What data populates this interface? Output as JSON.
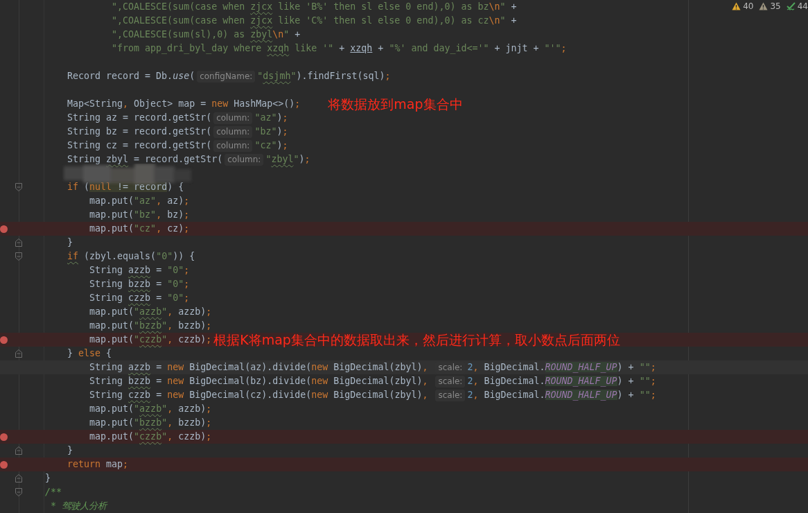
{
  "inspections": [
    {
      "kind": "warning",
      "count": "40"
    },
    {
      "kind": "weak-warning",
      "count": "35"
    },
    {
      "kind": "typo",
      "count": "44"
    }
  ],
  "redaction": {
    "kind": "mosaic"
  },
  "lines": [
    {
      "tokens": [
        {
          "kind": "str",
          "text": "            \",COALESCE(sum(case when "
        },
        {
          "kind": "str",
          "text": "zjcx",
          "typo": true
        },
        {
          "kind": "str",
          "text": " like 'B%' then sl else 0 end),0) as bz"
        },
        {
          "kind": "esc",
          "text": "\\n"
        },
        {
          "kind": "str",
          "text": "\""
        },
        {
          "kind": "plain",
          "text": " +"
        }
      ]
    },
    {
      "tokens": [
        {
          "kind": "str",
          "text": "            \",COALESCE(sum(case when "
        },
        {
          "kind": "str",
          "text": "zjcx",
          "typo": true
        },
        {
          "kind": "str",
          "text": " like 'C%' then sl else 0 end),0) as cz"
        },
        {
          "kind": "esc",
          "text": "\\n"
        },
        {
          "kind": "str",
          "text": "\""
        },
        {
          "kind": "plain",
          "text": " +"
        }
      ]
    },
    {
      "tokens": [
        {
          "kind": "str",
          "text": "            \",COALESCE(sum(sl),0) as "
        },
        {
          "kind": "str",
          "text": "zbyl",
          "typo": true
        },
        {
          "kind": "esc",
          "text": "\\n"
        },
        {
          "kind": "str",
          "text": "\""
        },
        {
          "kind": "plain",
          "text": " +"
        }
      ]
    },
    {
      "tokens": [
        {
          "kind": "str",
          "text": "            \"from app_dri_byl_day where "
        },
        {
          "kind": "str",
          "text": "xzqh",
          "typo": true
        },
        {
          "kind": "str",
          "text": " like '\""
        },
        {
          "kind": "plain",
          "text": " + "
        },
        {
          "kind": "param",
          "text": "xzqh"
        },
        {
          "kind": "plain",
          "text": " + "
        },
        {
          "kind": "str",
          "text": "\"%' and day_id<='\""
        },
        {
          "kind": "plain",
          "text": " + jnjt + "
        },
        {
          "kind": "str",
          "text": "\"'\""
        },
        {
          "kind": "kw",
          "text": ";"
        }
      ]
    },
    {
      "kind": "blank"
    },
    {
      "tokens": [
        {
          "kind": "plain",
          "text": "    Record record = Db."
        },
        {
          "kind": "static",
          "text": "use"
        },
        {
          "kind": "plain",
          "text": "("
        },
        {
          "kind": "hint",
          "text": "configName:"
        },
        {
          "kind": "str",
          "text": "\""
        },
        {
          "kind": "str",
          "text": "dsjmh",
          "typo": true
        },
        {
          "kind": "str",
          "text": "\""
        },
        {
          "kind": "plain",
          "text": ").findFirst(sql)"
        },
        {
          "kind": "kw",
          "text": ";"
        }
      ]
    },
    {
      "kind": "blank"
    },
    {
      "tokens": [
        {
          "kind": "plain",
          "text": "    Map<String"
        },
        {
          "kind": "kw",
          "text": ","
        },
        {
          "kind": "plain",
          "text": " Object> map = "
        },
        {
          "kind": "kw",
          "text": "new"
        },
        {
          "kind": "plain",
          "text": " HashMap<>()"
        },
        {
          "kind": "kw",
          "text": ";"
        }
      ],
      "note": "将数据放到map集合中"
    },
    {
      "tokens": [
        {
          "kind": "plain",
          "text": "    String az = record.getStr("
        },
        {
          "kind": "hint",
          "text": "column:"
        },
        {
          "kind": "str",
          "text": "\"az\""
        },
        {
          "kind": "plain",
          "text": ")"
        },
        {
          "kind": "kw",
          "text": ";"
        }
      ]
    },
    {
      "tokens": [
        {
          "kind": "plain",
          "text": "    String bz = record.getStr("
        },
        {
          "kind": "hint",
          "text": "column:"
        },
        {
          "kind": "str",
          "text": "\"bz\""
        },
        {
          "kind": "plain",
          "text": ")"
        },
        {
          "kind": "kw",
          "text": ";"
        }
      ]
    },
    {
      "tokens": [
        {
          "kind": "plain",
          "text": "    String cz = record.getStr("
        },
        {
          "kind": "hint",
          "text": "column:"
        },
        {
          "kind": "str",
          "text": "\"cz\""
        },
        {
          "kind": "plain",
          "text": ")"
        },
        {
          "kind": "kw",
          "text": ";"
        }
      ]
    },
    {
      "tokens": [
        {
          "kind": "plain",
          "text": "    String "
        },
        {
          "kind": "plain",
          "text": "zbyl",
          "typo": true
        },
        {
          "kind": "plain",
          "text": " = record.getStr("
        },
        {
          "kind": "hint",
          "text": "column:"
        },
        {
          "kind": "str",
          "text": "\""
        },
        {
          "kind": "str",
          "text": "zbyl",
          "typo": true
        },
        {
          "kind": "str",
          "text": "\""
        },
        {
          "kind": "plain",
          "text": ")"
        },
        {
          "kind": "kw",
          "text": ";"
        }
      ]
    },
    {
      "kind": "blank"
    },
    {
      "fold_start": true,
      "tokens": [
        {
          "kind": "kw",
          "text": "    if"
        },
        {
          "kind": "plain",
          "text": " ("
        },
        {
          "kind": "kw",
          "text": "null",
          "highlight": true
        },
        {
          "kind": "plain",
          "text": " != record",
          "highlight": true
        },
        {
          "kind": "plain",
          "text": ") {"
        }
      ]
    },
    {
      "tokens": [
        {
          "kind": "plain",
          "text": "        map.put("
        },
        {
          "kind": "str",
          "text": "\"az\""
        },
        {
          "kind": "kw",
          "text": ","
        },
        {
          "kind": "plain",
          "text": " az)"
        },
        {
          "kind": "kw",
          "text": ";"
        }
      ]
    },
    {
      "tokens": [
        {
          "kind": "plain",
          "text": "        map.put("
        },
        {
          "kind": "str",
          "text": "\"bz\""
        },
        {
          "kind": "kw",
          "text": ","
        },
        {
          "kind": "plain",
          "text": " bz)"
        },
        {
          "kind": "kw",
          "text": ";"
        }
      ]
    },
    {
      "breakpoint": true,
      "tokens": [
        {
          "kind": "plain",
          "text": "        map.put("
        },
        {
          "kind": "str",
          "text": "\"cz\""
        },
        {
          "kind": "kw",
          "text": ","
        },
        {
          "kind": "plain",
          "text": " cz)"
        },
        {
          "kind": "kw",
          "text": ";"
        }
      ]
    },
    {
      "fold_end": true,
      "tokens": [
        {
          "kind": "plain",
          "text": "    }"
        }
      ]
    },
    {
      "fold_start": true,
      "tokens": [
        {
          "kind": "kw",
          "text": "    if",
          "typo": true
        },
        {
          "kind": "plain",
          "text": " (zbyl.equals("
        },
        {
          "kind": "str",
          "text": "\"0\""
        },
        {
          "kind": "plain",
          "text": ")) {"
        }
      ]
    },
    {
      "tokens": [
        {
          "kind": "plain",
          "text": "        String "
        },
        {
          "kind": "plain",
          "text": "azzb",
          "typo": true
        },
        {
          "kind": "plain",
          "text": " = "
        },
        {
          "kind": "str",
          "text": "\"0\""
        },
        {
          "kind": "kw",
          "text": ";"
        }
      ]
    },
    {
      "tokens": [
        {
          "kind": "plain",
          "text": "        String "
        },
        {
          "kind": "plain",
          "text": "bzzb",
          "typo": true
        },
        {
          "kind": "plain",
          "text": " = "
        },
        {
          "kind": "str",
          "text": "\"0\""
        },
        {
          "kind": "kw",
          "text": ";"
        }
      ]
    },
    {
      "tokens": [
        {
          "kind": "plain",
          "text": "        String "
        },
        {
          "kind": "plain",
          "text": "czzb",
          "typo": true
        },
        {
          "kind": "plain",
          "text": " = "
        },
        {
          "kind": "str",
          "text": "\"0\""
        },
        {
          "kind": "kw",
          "text": ";"
        }
      ]
    },
    {
      "tokens": [
        {
          "kind": "plain",
          "text": "        map.put("
        },
        {
          "kind": "str",
          "text": "\""
        },
        {
          "kind": "str",
          "text": "azzb",
          "typo": true
        },
        {
          "kind": "str",
          "text": "\""
        },
        {
          "kind": "kw",
          "text": ","
        },
        {
          "kind": "plain",
          "text": " azzb)"
        },
        {
          "kind": "kw",
          "text": ";"
        }
      ]
    },
    {
      "tokens": [
        {
          "kind": "plain",
          "text": "        map.put("
        },
        {
          "kind": "str",
          "text": "\""
        },
        {
          "kind": "str",
          "text": "bzzb",
          "typo": true
        },
        {
          "kind": "str",
          "text": "\""
        },
        {
          "kind": "kw",
          "text": ","
        },
        {
          "kind": "plain",
          "text": " bzzb)"
        },
        {
          "kind": "kw",
          "text": ";"
        }
      ]
    },
    {
      "breakpoint": true,
      "tokens": [
        {
          "kind": "plain",
          "text": "        map.put("
        },
        {
          "kind": "str",
          "text": "\""
        },
        {
          "kind": "str",
          "text": "czzb",
          "typo": true
        },
        {
          "kind": "str",
          "text": "\""
        },
        {
          "kind": "kw",
          "text": ","
        },
        {
          "kind": "plain",
          "text": " czzb)"
        },
        {
          "kind": "kw",
          "text": ";"
        }
      ],
      "note": "根据K将map集合中的数据取出来，然后进行计算，取小数点后面两位"
    },
    {
      "fold_end": true,
      "tokens": [
        {
          "kind": "plain",
          "text": "    } "
        },
        {
          "kind": "kw",
          "text": "else"
        },
        {
          "kind": "plain",
          "text": " {"
        }
      ]
    },
    {
      "current": true,
      "tokens": [
        {
          "kind": "plain",
          "text": "        String "
        },
        {
          "kind": "plain",
          "text": "azzb",
          "typo": true
        },
        {
          "kind": "plain",
          "text": " = "
        },
        {
          "kind": "kw",
          "text": "new"
        },
        {
          "kind": "plain",
          "text": " BigDecimal(az).divide("
        },
        {
          "kind": "kw",
          "text": "new"
        },
        {
          "kind": "plain",
          "text": " BigDecimal(zbyl)"
        },
        {
          "kind": "kw",
          "text": ", "
        },
        {
          "kind": "hint",
          "text": "scale:"
        },
        {
          "kind": "num",
          "text": "2"
        },
        {
          "kind": "kw",
          "text": ","
        },
        {
          "kind": "plain",
          "text": " BigDecimal."
        },
        {
          "kind": "const",
          "text": "ROUND_HALF_UP",
          "highlight": true
        },
        {
          "kind": "plain",
          "text": ") + "
        },
        {
          "kind": "str",
          "text": "\"\""
        },
        {
          "kind": "kw",
          "text": ";"
        }
      ]
    },
    {
      "tokens": [
        {
          "kind": "plain",
          "text": "        String "
        },
        {
          "kind": "plain",
          "text": "bzzb",
          "typo": true
        },
        {
          "kind": "plain",
          "text": " = "
        },
        {
          "kind": "kw",
          "text": "new"
        },
        {
          "kind": "plain",
          "text": " BigDecimal(bz).divide("
        },
        {
          "kind": "kw",
          "text": "new"
        },
        {
          "kind": "plain",
          "text": " BigDecimal(zbyl)"
        },
        {
          "kind": "kw",
          "text": ", "
        },
        {
          "kind": "hint",
          "text": "scale:"
        },
        {
          "kind": "num",
          "text": "2"
        },
        {
          "kind": "kw",
          "text": ","
        },
        {
          "kind": "plain",
          "text": " BigDecimal."
        },
        {
          "kind": "const",
          "text": "ROUND_HALF_UP",
          "highlight": true
        },
        {
          "kind": "plain",
          "text": ") + "
        },
        {
          "kind": "str",
          "text": "\"\""
        },
        {
          "kind": "kw",
          "text": ";"
        }
      ]
    },
    {
      "tokens": [
        {
          "kind": "plain",
          "text": "        String "
        },
        {
          "kind": "plain",
          "text": "czzb",
          "typo": true
        },
        {
          "kind": "plain",
          "text": " = "
        },
        {
          "kind": "kw",
          "text": "new"
        },
        {
          "kind": "plain",
          "text": " BigDecimal(cz).divide("
        },
        {
          "kind": "kw",
          "text": "new"
        },
        {
          "kind": "plain",
          "text": " BigDecimal(zbyl)"
        },
        {
          "kind": "kw",
          "text": ", "
        },
        {
          "kind": "hint",
          "text": "scale:"
        },
        {
          "kind": "num",
          "text": "2"
        },
        {
          "kind": "kw",
          "text": ","
        },
        {
          "kind": "plain",
          "text": " BigDecimal."
        },
        {
          "kind": "const",
          "text": "ROUND_HALF_UP",
          "highlight": true
        },
        {
          "kind": "plain",
          "text": ") + "
        },
        {
          "kind": "str",
          "text": "\"\""
        },
        {
          "kind": "kw",
          "text": ";"
        }
      ]
    },
    {
      "tokens": [
        {
          "kind": "plain",
          "text": "        map.put("
        },
        {
          "kind": "str",
          "text": "\""
        },
        {
          "kind": "str",
          "text": "azzb",
          "typo": true
        },
        {
          "kind": "str",
          "text": "\""
        },
        {
          "kind": "kw",
          "text": ","
        },
        {
          "kind": "plain",
          "text": " azzb)"
        },
        {
          "kind": "kw",
          "text": ";"
        }
      ]
    },
    {
      "tokens": [
        {
          "kind": "plain",
          "text": "        map.put("
        },
        {
          "kind": "str",
          "text": "\""
        },
        {
          "kind": "str",
          "text": "bzzb",
          "typo": true
        },
        {
          "kind": "str",
          "text": "\""
        },
        {
          "kind": "kw",
          "text": ","
        },
        {
          "kind": "plain",
          "text": " bzzb)"
        },
        {
          "kind": "kw",
          "text": ";"
        }
      ]
    },
    {
      "breakpoint": true,
      "tokens": [
        {
          "kind": "plain",
          "text": "        map.put("
        },
        {
          "kind": "str",
          "text": "\""
        },
        {
          "kind": "str",
          "text": "czzb",
          "typo": true
        },
        {
          "kind": "str",
          "text": "\""
        },
        {
          "kind": "kw",
          "text": ","
        },
        {
          "kind": "plain",
          "text": " czzb)"
        },
        {
          "kind": "kw",
          "text": ";"
        }
      ]
    },
    {
      "fold_end": true,
      "tokens": [
        {
          "kind": "plain",
          "text": "    }"
        }
      ]
    },
    {
      "breakpoint": true,
      "tokens": [
        {
          "kind": "kw",
          "text": "    return"
        },
        {
          "kind": "plain",
          "text": " map"
        },
        {
          "kind": "kw",
          "text": ";"
        }
      ]
    },
    {
      "fold_end": true,
      "tokens": [
        {
          "kind": "plain",
          "text": "}"
        }
      ]
    },
    {
      "fold_start": true,
      "tokens": [
        {
          "kind": "comment",
          "text": "/**"
        }
      ]
    },
    {
      "tokens": [
        {
          "kind": "comment",
          "text": " * 驾驶人分析"
        }
      ]
    }
  ]
}
